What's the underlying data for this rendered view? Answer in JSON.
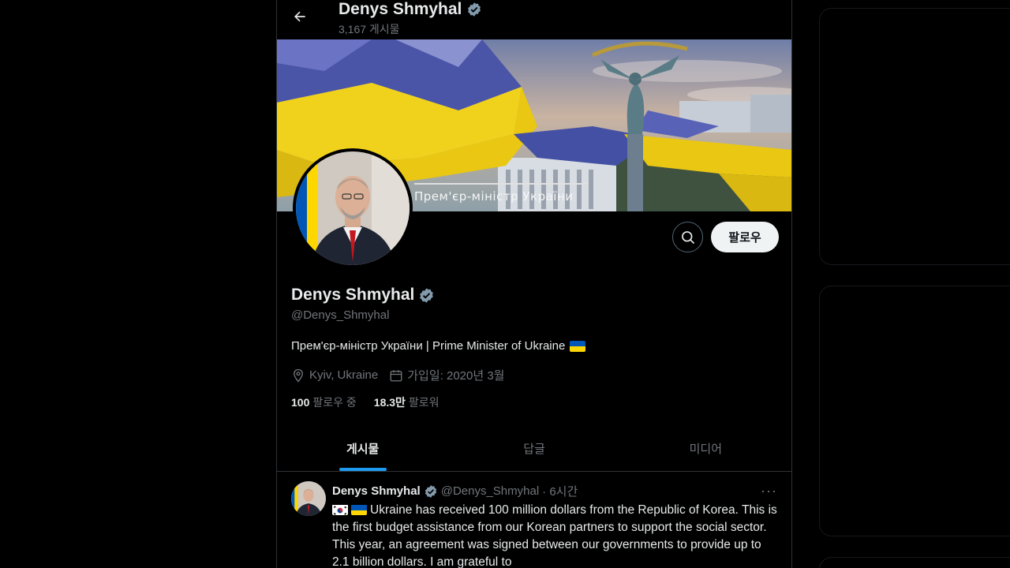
{
  "header": {
    "name": "Denys Shmyhal",
    "post_count": "3,167 게시물"
  },
  "banner": {
    "caption": "Прем'єр-міністр України"
  },
  "actions": {
    "follow_label": "팔로우"
  },
  "profile": {
    "name": "Denys Shmyhal",
    "handle": "@Denys_Shmyhal",
    "bio": "Прем'єр-міністр України | Prime Minister of Ukraine",
    "location": "Kyiv, Ukraine",
    "joined": "가입일: 2020년 3월",
    "following_count": "100",
    "following_label": "팔로우 중",
    "followers_count": "18.3만",
    "followers_label": "팔로워"
  },
  "tabs": [
    {
      "label": "게시물",
      "active": true
    },
    {
      "label": "답글",
      "active": false
    },
    {
      "label": "미디어",
      "active": false
    }
  ],
  "post": {
    "name": "Denys Shmyhal",
    "handle": "@Denys_Shmyhal",
    "time": "· 6시간",
    "more": "···",
    "text": "Ukraine has received 100 million dollars from the Republic of Korea. This is the first budget assistance from our Korean partners to support the social sector. This year, an agreement was signed between our governments to provide up to 2.1 billion dollars. I am grateful to"
  },
  "colors": {
    "accent": "#1d9bf0",
    "verified": "#829aab",
    "ukraine_blue": "#0057b7",
    "ukraine_yellow": "#ffd700"
  },
  "icons": [
    "back-arrow-icon",
    "verified-badge-icon",
    "search-icon",
    "location-pin-icon",
    "calendar-icon",
    "ukraine-flag-icon",
    "korea-flag-icon"
  ]
}
